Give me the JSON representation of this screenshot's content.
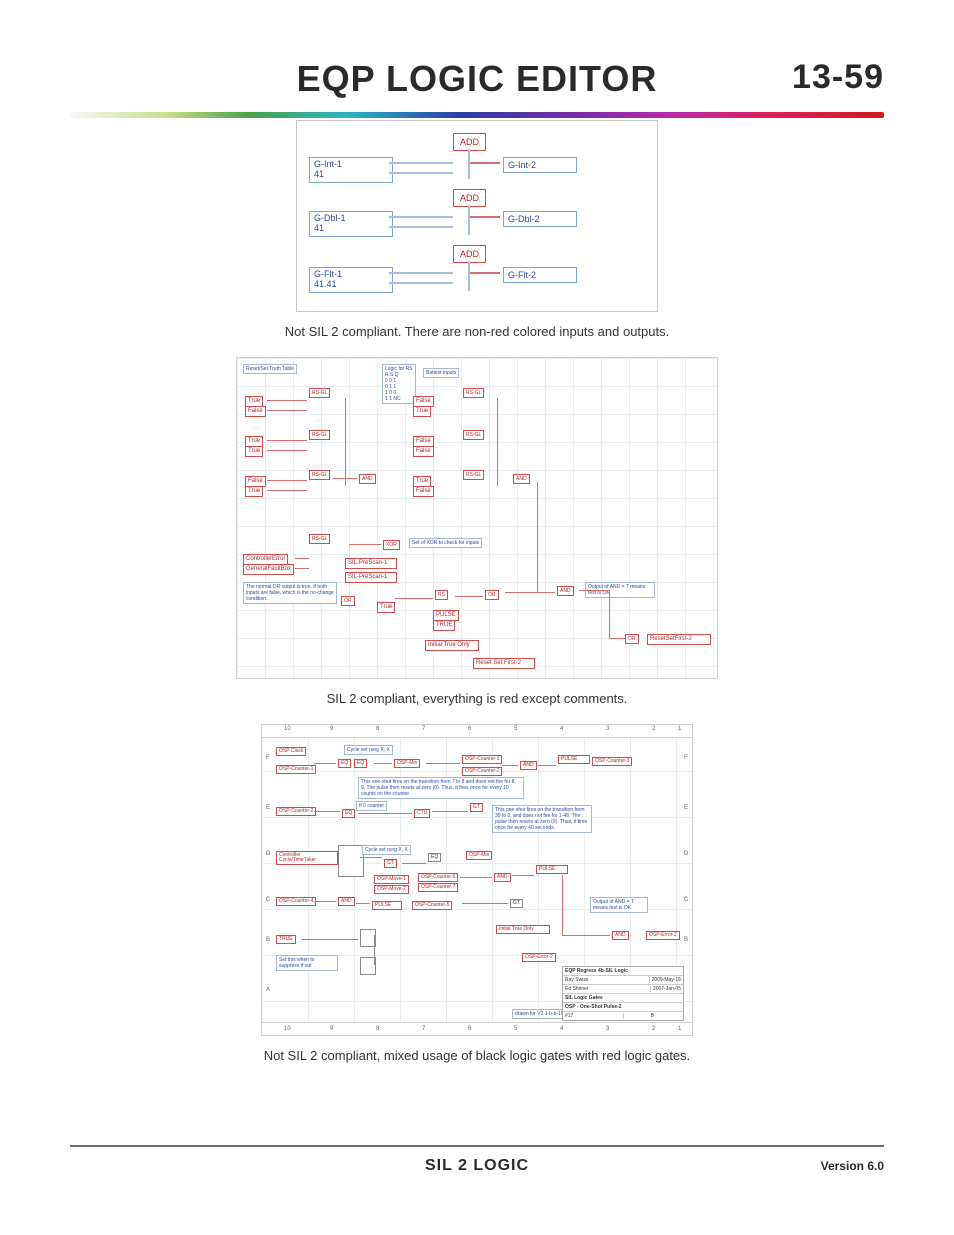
{
  "header": {
    "title": "EQP LOGIC EDITOR",
    "page": "13-59"
  },
  "captions": {
    "c1": "Not SIL 2 compliant. There are non-red colored inputs and outputs.",
    "c2": "SIL 2 compliant, everything is red except comments.",
    "c3": "Not SIL 2 compliant, mixed usage of black logic gates with red logic gates."
  },
  "fig1": {
    "rows": [
      {
        "in": "G-Int-1",
        "val": "41",
        "op": "ADD",
        "out": "G-Int-2"
      },
      {
        "in": "G-Dbl-1",
        "val": "41",
        "op": "ADD",
        "out": "G-Dbl-2"
      },
      {
        "in": "G-Flt-1",
        "val": "41.41",
        "op": "ADD",
        "out": "G-Flt-2"
      }
    ]
  },
  "fig2": {
    "title_label": "Reset/Set Truth Table",
    "truth_label": "Logic for RS",
    "truth_rows": [
      "R  S  Q",
      "0  0  1",
      "0  1  1",
      "1  0  0",
      "1  1  NC"
    ],
    "battest": "Battest inputs",
    "gates": {
      "rsgl": "RS-GL",
      "and": "AND",
      "or": "OR",
      "xor": "XOR",
      "rs": "RS"
    },
    "labels": {
      "true": "True",
      "false": "False",
      "controllerError": "ControllerError",
      "generalFaultBox": "GeneralFaultBox",
      "prescan1": "SIL-PreScan-1",
      "xorcheck": "Set of XOR to check for inputs",
      "note1": "The normal OR output is true. If both inputs are false, which is the no-change condition.",
      "initial": "Initial True Only",
      "resetfirst2": "Reset Set First-2",
      "resetout": "ResetSetFirst-2",
      "andnote": "Output of AND = T means test is OK.",
      "pulse": "PULSE",
      "true2": "TRUE"
    }
  },
  "fig3": {
    "ruler": [
      "10",
      "9",
      "8",
      "7",
      "6",
      "5",
      "4",
      "3",
      "2",
      "1"
    ],
    "rows": [
      "F",
      "E",
      "D",
      "C",
      "B",
      "A"
    ],
    "labels": {
      "ospclock": "OSP Clock",
      "ospcounter1": "OSP-Counter-1",
      "ospcounter2": "OSP-Counter-2",
      "ospcounter3": "OSP-Counter-3",
      "ospcounter4": "OSP-Counter-4",
      "ospcounter5": "OSP-Counter-5",
      "ospcounter6": "OSP-Counter-6",
      "ospcounter7": "OSP-Counter-7",
      "osperror2": "OSP-Error-2",
      "cycle": "Cycle set rung X, X",
      "ctrlcycle": "Controller Cycle/TimeTaker",
      "if0counter": "If 0 counter",
      "note1": "This one-shot fires on the transition from 7 to 8 and does not fire for 8, 9. The pulse then resets at zero (0). Thus, it fires once for every 10 counts on the counter.",
      "note2": "This one-shot fires on the transition from 39 to 0, and does not fire for 1-48. The pulse then resets at zero (0). Thus, it fires once for every 40 seconds.",
      "note3": "Set this when to suppress if out",
      "andnote": "Output of AND = T means test is OK.",
      "initial": "Initial True Only",
      "pulse": "PULSE",
      "true": "TRUE",
      "eqgates": "EQ",
      "gt": "GT",
      "and": "AND",
      "ctu": "CTU",
      "osptag": "OSP-Min",
      "ospmove": "OSP-Move-1",
      "ospmove2": "OSP-Move-2"
    },
    "titleblock": {
      "l1": "EQP Regress 4b-SIL Logic",
      "l2a": "Ray Swiss",
      "l2b": "2009-May-16",
      "l3a": "Ed Shriner",
      "l3b": "2007-Jan-05",
      "l4": "SIL Logic Gates",
      "l5": "OSP - One-Shot Pulse-2",
      "rev": "#17",
      "sheet": "B",
      "drawn": "drawn for V2.1-b-b-16"
    }
  },
  "footer": {
    "section": "SIL 2 LOGIC",
    "version": "Version 6.0"
  }
}
